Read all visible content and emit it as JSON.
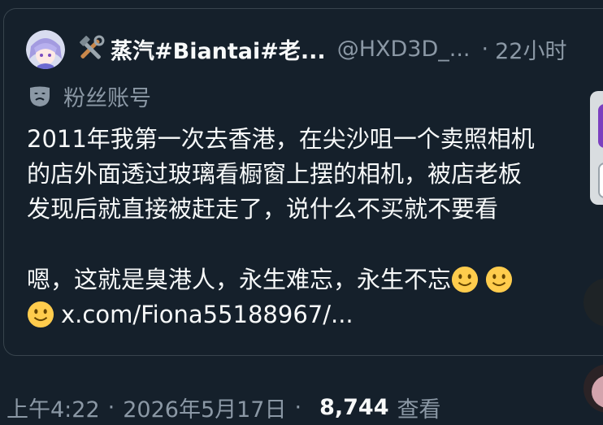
{
  "quoted_tweet": {
    "author": {
      "display_name": "🛠蒸汽#Biantai#老...",
      "display_name_text": "蒸汽#Biantai#老...",
      "handle": "@HXD3D_...",
      "separator": "·",
      "time_ago": "22小时"
    },
    "account_label": "粉丝账号",
    "text_lines": [
      "2011年我第一次去香港，在尖沙咀一个卖照相机",
      "的店外面透过玻璃看橱窗上摆的相机，被店老板",
      "发现后就直接被赶走了，说什么不买就不要看",
      "",
      "嗯，这就是臭港人，永生难忘，永生不忘"
    ],
    "link_text": "x.com/Fiona55188967/...",
    "emoji_icon": "slightly-smiling-face-icon"
  },
  "tweet_meta": {
    "time": "上午4:22",
    "separator": "·",
    "date": "2026年5月17日",
    "separator2": "·",
    "views_count": "8,744",
    "views_label": "查看"
  },
  "colors": {
    "background": "#15202b",
    "border": "#38444d",
    "primary_text": "#f7f9f9",
    "secondary_text": "#8b98a5"
  }
}
